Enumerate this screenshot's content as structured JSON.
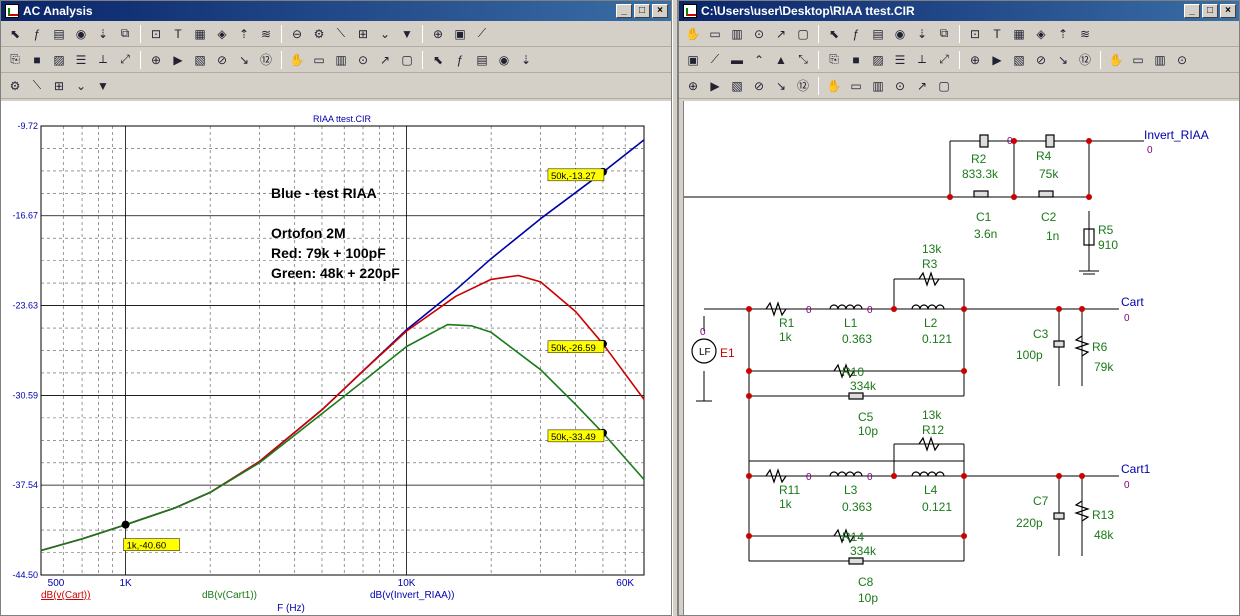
{
  "left_window": {
    "title": "AC Analysis",
    "toolbar1_icons": [
      "pointer-icon",
      "hand-icon",
      "zoom-window-icon",
      "copy-icon",
      "paste-icon",
      "properties-icon",
      "text-icon",
      "formula-icon",
      "text-tool-icon",
      "open-icon",
      "run-icon",
      "stop-icon",
      "cursor-a-icon",
      "cursor-b-icon",
      "table-icon",
      "grid1-icon",
      "grid2-icon",
      "grid3-icon",
      "grid4-icon",
      "layout-a-icon",
      "layout-b-icon"
    ],
    "toolbar2_icons": [
      "zoom-x-icon",
      "zoom-y-icon",
      "zoom-fit-icon",
      "zoom-in-x-icon",
      "legend-icon",
      "peak-icon",
      "valley-icon",
      "high-icon",
      "low-icon",
      "rise-icon",
      "fall-icon",
      "slope-icon",
      "max-icon",
      "min-icon",
      "sweep-icon",
      "copy-data-icon",
      "data-icon",
      "numbers-icon",
      "scale-icon",
      "fit-icon",
      "zoom-in-icon",
      "zoom-out-icon",
      "zoom-all-icon"
    ],
    "toolbar3_icons": [
      "grid-icon",
      "font-icon",
      "color-icon",
      "undo-icon",
      "redo-icon"
    ]
  },
  "right_window": {
    "title": "C:\\Users\\user\\Desktop\\RIAA ttest.CIR",
    "toolbar1_icons": [
      "pointer-icon",
      "hand-icon",
      "wire-icon",
      "text-icon",
      "probe-icon",
      "flag-icon",
      "component-icon",
      "copy-icon",
      "hierarchy-icon",
      "table-icon",
      "globe-icon",
      "info-icon",
      "help-icon",
      "network-icon",
      "check-icon",
      "props-icon",
      "list-icon",
      "edit-icon"
    ],
    "toolbar2_icons": [
      "select-text-icon",
      "select-wire-icon",
      "node-icon",
      "arrow-icon",
      "voltage-probe-icon",
      "current-icon",
      "power-icon",
      "ground-icon",
      "plus-icon",
      "warning-icon",
      "grid-icon",
      "page-icon",
      "doc-icon",
      "sheet-icon",
      "rubber-icon",
      "open-icon",
      "select-icon",
      "box-icon",
      "frame-icon",
      "bracket-icon",
      "split-icon",
      "table-icon"
    ],
    "toolbar3_icons": [
      "record-icon",
      "cancel-icon",
      "dots-icon",
      "undo-icon",
      "redo-icon",
      "zoom-in-icon",
      "zoom-out-icon",
      "zoom-fit-icon",
      "print-icon",
      "grid-icon",
      "font-icon",
      "color-icon"
    ]
  },
  "plot": {
    "title": "RIAA ttest.CIR",
    "x_axis_label": "F (Hz)",
    "annotation": {
      "line1": "Blue - test RIAA",
      "line2": "Ortofon 2M",
      "line3": "Red: 79k + 100pF",
      "line4": "Green: 48k + 220pF"
    },
    "legend": {
      "red": "dB(v(Cart))",
      "green": "dB(v(Cart1))",
      "blue": "dB(v(Invert_RIAA))"
    },
    "markers": [
      {
        "label": "50k,-13.27",
        "x": 50000,
        "y": -13.27,
        "color": "#0000aa"
      },
      {
        "label": "50k,-26.59",
        "x": 50000,
        "y": -26.59,
        "color": "#cc0000"
      },
      {
        "label": "50k,-33.49",
        "x": 50000,
        "y": -33.49,
        "color": "#1a7a1a"
      },
      {
        "label": "1k,-40.60",
        "x": 1000,
        "y": -40.6,
        "color": "#0000aa"
      }
    ]
  },
  "chart_data": {
    "type": "line",
    "title": "RIAA ttest.CIR",
    "xlabel": "F (Hz)",
    "ylabel": "",
    "x_scale": "log",
    "xlim": [
      500,
      70000
    ],
    "ylim": [
      -44.5,
      -9.72
    ],
    "x_ticks": [
      "500",
      "1K",
      "10K",
      "60K"
    ],
    "y_ticks": [
      "-9.72",
      "-16.67",
      "-23.63",
      "-30.59",
      "-37.54",
      "-44.50"
    ],
    "grid": true,
    "series": [
      {
        "name": "dB(v(Invert_RIAA))",
        "color": "#0000aa",
        "x": [
          500,
          700,
          1000,
          1500,
          2000,
          3000,
          5000,
          7000,
          10000,
          15000,
          20000,
          30000,
          50000,
          70000
        ],
        "y": [
          -42.6,
          -41.7,
          -40.6,
          -39.3,
          -38.1,
          -35.7,
          -31.7,
          -28.7,
          -25.5,
          -22.4,
          -20.0,
          -16.9,
          -13.3,
          -10.8
        ]
      },
      {
        "name": "dB(v(Cart))",
        "color": "#cc0000",
        "x": [
          500,
          700,
          1000,
          1500,
          2000,
          3000,
          5000,
          7000,
          10000,
          15000,
          20000,
          25000,
          30000,
          40000,
          50000,
          70000
        ],
        "y": [
          -42.6,
          -41.7,
          -40.6,
          -39.3,
          -38.1,
          -35.7,
          -31.7,
          -28.7,
          -25.6,
          -22.9,
          -21.6,
          -21.3,
          -21.8,
          -24.1,
          -26.59,
          -30.9
        ]
      },
      {
        "name": "dB(v(Cart1))",
        "color": "#1a7a1a",
        "x": [
          500,
          700,
          1000,
          1500,
          2000,
          3000,
          5000,
          7000,
          10000,
          14000,
          17000,
          20000,
          30000,
          40000,
          50000,
          70000
        ],
        "y": [
          -42.6,
          -41.7,
          -40.6,
          -39.3,
          -38.1,
          -35.8,
          -32.0,
          -29.5,
          -26.8,
          -25.1,
          -25.2,
          -25.7,
          -28.6,
          -31.3,
          -33.49,
          -37.1
        ]
      }
    ]
  },
  "schematic": {
    "labels": {
      "invert_riaa": "Invert_RIAA",
      "cart": "Cart",
      "cart1": "Cart1",
      "node0": "0",
      "source": "LF",
      "source_name": "E1",
      "r2": "R2",
      "r2_val": "833.3k",
      "r4": "R4",
      "r4_val": "75k",
      "c1": "C1",
      "c1_val": "3.6n",
      "c2": "C2",
      "c2_val": "1n",
      "r5": "R5",
      "r5_val": "910",
      "r3": "R3",
      "r3_val": "13k",
      "r1": "R1",
      "r1_val": "1k",
      "l1": "L1",
      "l1_val": "0.363",
      "l2": "L2",
      "l2_val": "0.121",
      "r10": "R10",
      "r10_val": "334k",
      "c5": "C5",
      "c5_val": "10p",
      "c3": "C3",
      "c3_val": "100p",
      "r6": "R6",
      "r6_val": "79k",
      "r12": "R12",
      "r12_val": "13k",
      "r11": "R11",
      "r11_val": "1k",
      "l3": "L3",
      "l3_val": "0.363",
      "l4": "L4",
      "l4_val": "0.121",
      "r14": "R14",
      "r14_val": "334k",
      "c8": "C8",
      "c8_val": "10p",
      "c7": "C7",
      "c7_val": "220p",
      "r13": "R13",
      "r13_val": "48k"
    }
  },
  "colors": {
    "titlebar": "#0a246a",
    "marker_bg": "#ffff00",
    "wire": "#000000",
    "component_label": "#1a7a1a",
    "node_label": "#800080",
    "net_label": "#0000aa"
  }
}
